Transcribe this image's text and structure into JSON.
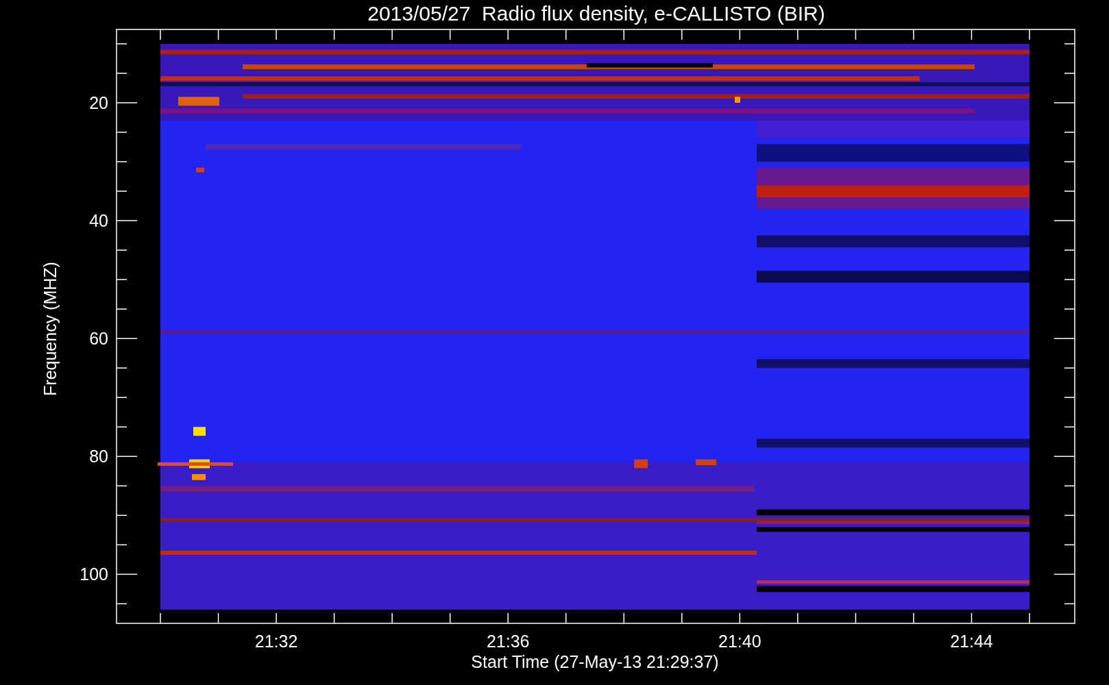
{
  "plot": {
    "title": "2013/05/27  Radio flux density, e-CALLISTO (BIR)",
    "xlabel": "Start Time (27-May-13 21:29:37)",
    "ylabel": "Frequency (MHZ)",
    "xtick_labels": [
      "21:32",
      "21:36",
      "21:40",
      "21:44"
    ],
    "ytick_labels": [
      "20",
      "40",
      "60",
      "80",
      "100"
    ]
  }
}
